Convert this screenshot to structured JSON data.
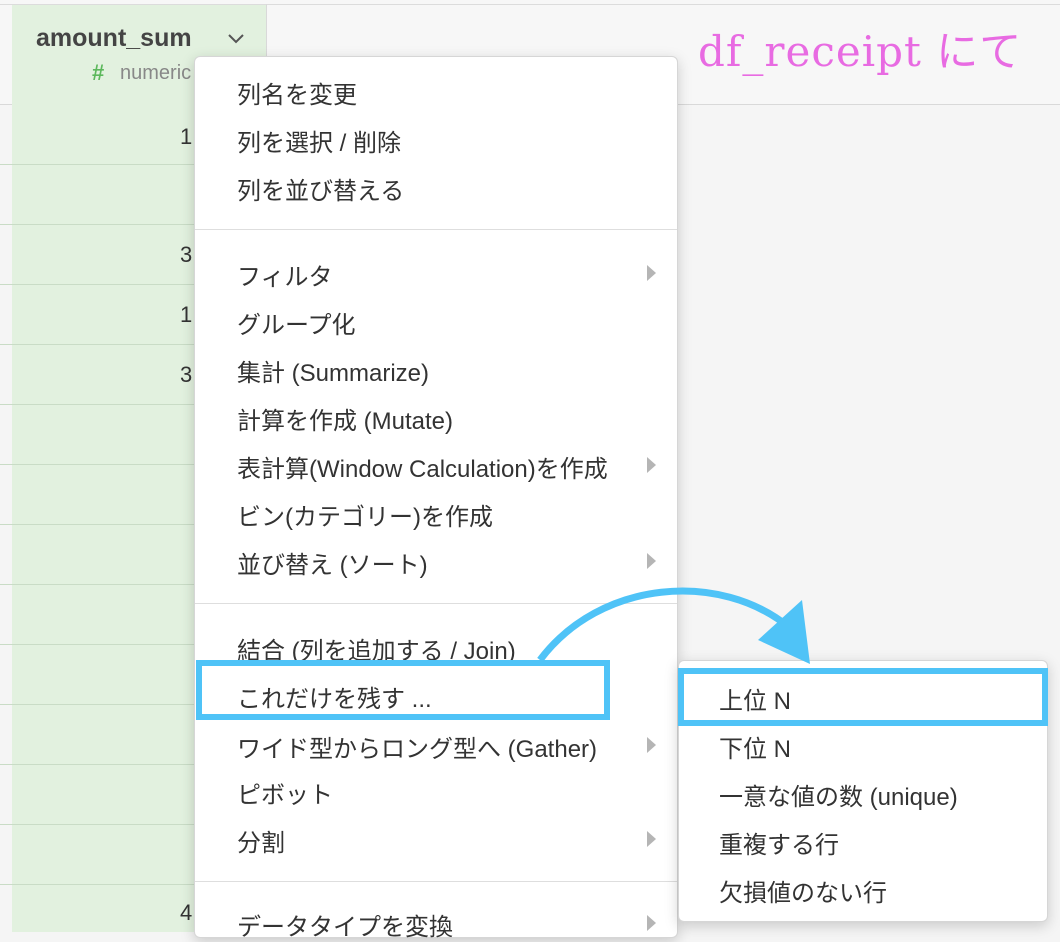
{
  "table": {
    "column_name": "amount_sum",
    "column_type": "numeric",
    "visible_cells": [
      "1",
      "3",
      "1",
      "3",
      "4"
    ]
  },
  "annotation": {
    "title": "df_receipt にて",
    "color": "#e86be2",
    "highlight_color": "#4fc3f7"
  },
  "menu": {
    "group1": [
      "列名を変更",
      "列を選択 / 削除",
      "列を並び替える"
    ],
    "group2": [
      "フィルタ",
      "グループ化",
      "集計 (Summarize)",
      "計算を作成 (Mutate)",
      "表計算(Window Calculation)を作成",
      "ビン(カテゴリー)を作成",
      "並び替え (ソート)"
    ],
    "group3": [
      "結合 (列を追加する / Join)",
      "これだけを残す ...",
      "ワイド型からロング型へ (Gather)",
      "ピボット",
      "分割"
    ],
    "group4": [
      "データタイプを変換"
    ]
  },
  "submenu": {
    "items": [
      "上位 N",
      "下位 N",
      "一意な値の数 (unique)",
      "重複する行",
      "欠損値のない行"
    ]
  }
}
